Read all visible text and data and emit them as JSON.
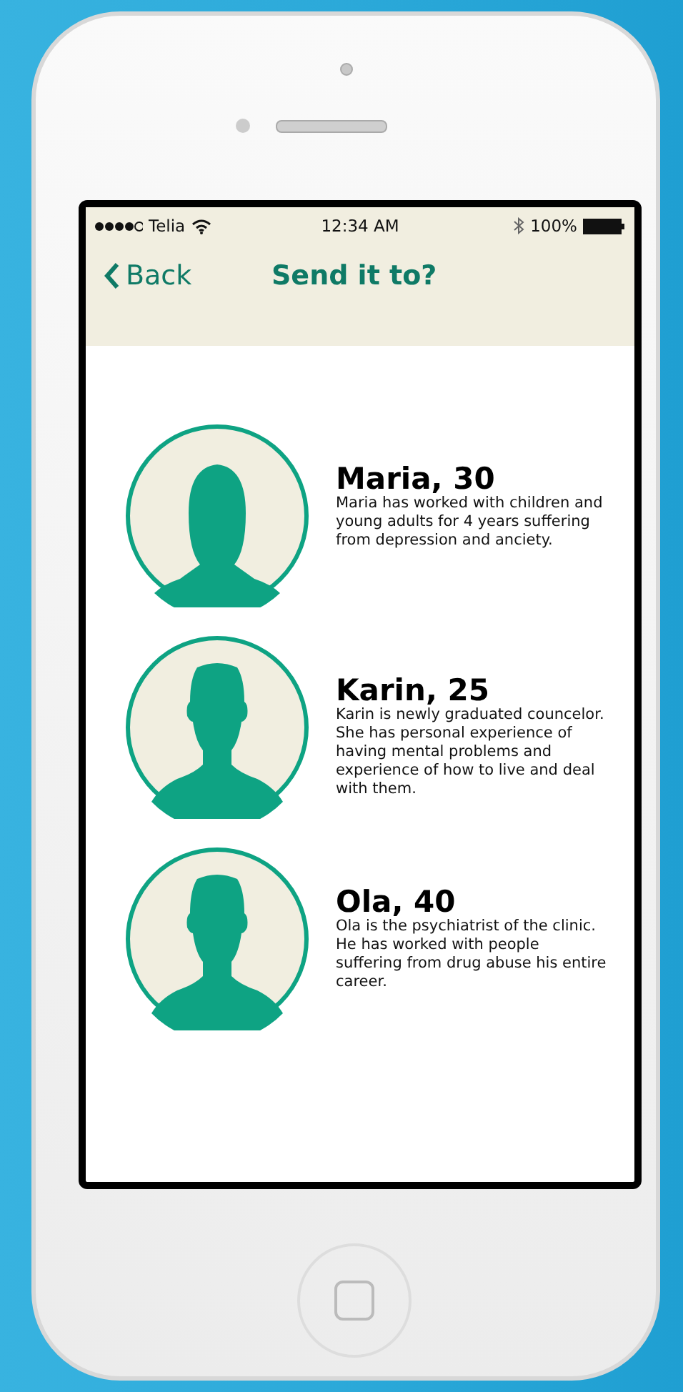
{
  "status_bar": {
    "carrier": "Telia",
    "time": "12:34 AM",
    "battery": "100%"
  },
  "nav": {
    "back": "Back",
    "title": "Send it to?"
  },
  "people": [
    {
      "kind": "female",
      "name": "Maria, 30",
      "description": "Maria has worked with children and young adults for 4 years suffering from depression and anciety."
    },
    {
      "kind": "male",
      "name": "Karin, 25",
      "description": "Karin is newly graduated councelor. She has personal experience of having mental problems and experience of how to live and deal with them."
    },
    {
      "kind": "male",
      "name": "Ola, 40",
      "description": "Ola is the psychiatrist of the clinic. He has worked with people suffering from drug abuse his entire career."
    }
  ]
}
